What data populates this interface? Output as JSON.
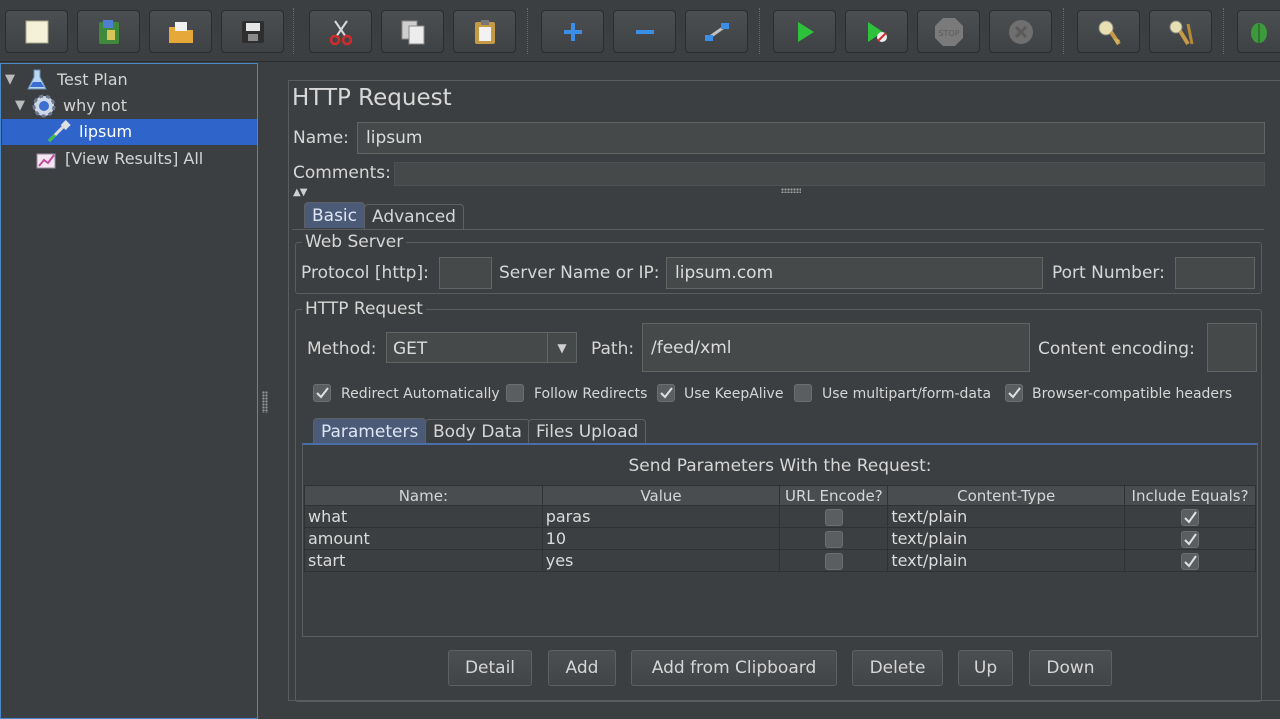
{
  "toolbar": {
    "buttons": [
      {
        "name": "new-icon"
      },
      {
        "name": "templates-icon"
      },
      {
        "name": "open-icon"
      },
      {
        "name": "save-icon"
      },
      {
        "name": "cut-icon"
      },
      {
        "name": "copy-icon"
      },
      {
        "name": "paste-icon"
      },
      {
        "name": "expand-icon"
      },
      {
        "name": "collapse-icon"
      },
      {
        "name": "toggle-icon"
      },
      {
        "name": "start-icon"
      },
      {
        "name": "start-no-pauses-icon"
      },
      {
        "name": "stop-icon"
      },
      {
        "name": "shutdown-icon"
      },
      {
        "name": "clear-icon"
      },
      {
        "name": "clear-all-icon"
      },
      {
        "name": "search-icon"
      }
    ]
  },
  "tree": {
    "items": [
      {
        "label": "Test Plan",
        "icon": "test-plan-flask-icon"
      },
      {
        "label": "why not",
        "icon": "thread-group-gear-icon"
      },
      {
        "label": "lipsum",
        "icon": "http-sampler-pipette-icon",
        "selected": true
      },
      {
        "label": "[View Results] All",
        "icon": "listener-chart-icon"
      }
    ]
  },
  "main": {
    "title": "HTTP Request",
    "name_label": "Name:",
    "name_value": "lipsum",
    "comments_label": "Comments:",
    "comments_value": "",
    "tabs": [
      {
        "label": "Basic",
        "active": true
      },
      {
        "label": "Advanced",
        "active": false
      }
    ],
    "web_server": {
      "title": "Web Server",
      "protocol_label": "Protocol [http]:",
      "protocol_value": "",
      "server_label": "Server Name or IP:",
      "server_value": "lipsum.com",
      "port_label": "Port Number:",
      "port_value": ""
    },
    "http_request": {
      "title": "HTTP Request",
      "method_label": "Method:",
      "method_value": "GET",
      "path_label": "Path:",
      "path_value": "/feed/xml",
      "encoding_label": "Content encoding:",
      "encoding_value": ""
    },
    "options": [
      {
        "label": "Redirect Automatically",
        "checked": true
      },
      {
        "label": "Follow Redirects",
        "checked": false
      },
      {
        "label": "Use KeepAlive",
        "checked": true
      },
      {
        "label": "Use multipart/form-data",
        "checked": false
      },
      {
        "label": "Browser-compatible headers",
        "checked": true
      }
    ],
    "sub_tabs": [
      {
        "label": "Parameters",
        "active": true
      },
      {
        "label": "Body Data",
        "active": false
      },
      {
        "label": "Files Upload",
        "active": false
      }
    ],
    "params": {
      "title": "Send Parameters With the Request:",
      "columns": [
        "Name:",
        "Value",
        "URL Encode?",
        "Content-Type",
        "Include Equals?"
      ],
      "rows": [
        {
          "name": "what",
          "value": "paras",
          "url_encode": false,
          "content_type": "text/plain",
          "include_equals": true
        },
        {
          "name": "amount",
          "value": "10",
          "url_encode": false,
          "content_type": "text/plain",
          "include_equals": true
        },
        {
          "name": "start",
          "value": "yes",
          "url_encode": false,
          "content_type": "text/plain",
          "include_equals": true
        }
      ]
    },
    "buttons": {
      "detail": "Detail",
      "add": "Add",
      "add_clipboard": "Add from Clipboard",
      "delete": "Delete",
      "up": "Up",
      "down": "Down"
    }
  },
  "colors": {
    "background": "#3c3f41",
    "selection": "#2f65ca",
    "active_tab": "#4a5a77",
    "run_green": "#2ec23c"
  }
}
